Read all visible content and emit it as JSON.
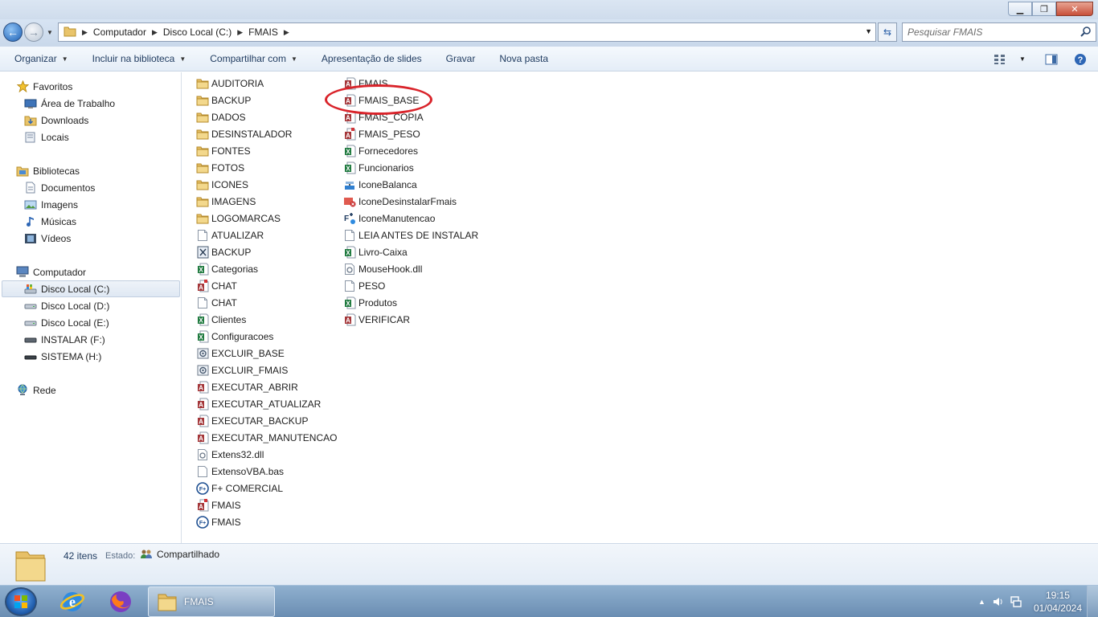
{
  "window": {
    "min_label": "▁",
    "max_label": "❐",
    "close_label": "✕"
  },
  "address": {
    "crumbs": [
      "Computador",
      "Disco Local (C:)",
      "FMAIS"
    ],
    "search_placeholder": "Pesquisar FMAIS"
  },
  "toolbar": {
    "items": [
      "Organizar",
      "Incluir na biblioteca",
      "Compartilhar com",
      "Apresentação de slides",
      "Gravar",
      "Nova pasta"
    ]
  },
  "nav": {
    "favorites": {
      "title": "Favoritos",
      "items": [
        "Área de Trabalho",
        "Downloads",
        "Locais"
      ]
    },
    "libraries": {
      "title": "Bibliotecas",
      "items": [
        "Documentos",
        "Imagens",
        "Músicas",
        "Vídeos"
      ]
    },
    "computer": {
      "title": "Computador",
      "items": [
        "Disco Local (C:)",
        "Disco Local (D:)",
        "Disco Local (E:)",
        "INSTALAR (F:)",
        "SISTEMA (H:)"
      ]
    },
    "network": {
      "title": "Rede"
    }
  },
  "files": {
    "col1": [
      {
        "name": "AUDITORIA",
        "icon": "folder-icon"
      },
      {
        "name": "BACKUP",
        "icon": "folder-icon"
      },
      {
        "name": "DADOS",
        "icon": "folder-icon"
      },
      {
        "name": "DESINSTALADOR",
        "icon": "folder-icon"
      },
      {
        "name": "FONTES",
        "icon": "folder-icon"
      },
      {
        "name": "FOTOS",
        "icon": "folder-icon"
      },
      {
        "name": "ICONES",
        "icon": "folder-icon"
      },
      {
        "name": "IMAGENS",
        "icon": "folder-icon"
      },
      {
        "name": "LOGOMARCAS",
        "icon": "folder-icon"
      },
      {
        "name": "ATUALIZAR",
        "icon": "text-file-icon"
      },
      {
        "name": "BACKUP",
        "icon": "script-file-icon"
      },
      {
        "name": "Categorias",
        "icon": "excel-file-icon"
      },
      {
        "name": "CHAT",
        "icon": "access-lock-file-icon"
      },
      {
        "name": "CHAT",
        "icon": "text-file-icon"
      },
      {
        "name": "Clientes",
        "icon": "excel-file-icon"
      },
      {
        "name": "Configuracoes",
        "icon": "excel-file-icon"
      },
      {
        "name": "EXCLUIR_BASE",
        "icon": "batch-file-icon"
      },
      {
        "name": "EXCLUIR_FMAIS",
        "icon": "batch-file-icon"
      },
      {
        "name": "EXECUTAR_ABRIR",
        "icon": "access-file-icon"
      },
      {
        "name": "EXECUTAR_ATUALIZAR",
        "icon": "access-file-icon"
      },
      {
        "name": "EXECUTAR_BACKUP",
        "icon": "access-file-icon"
      },
      {
        "name": "EXECUTAR_MANUTENCAO",
        "icon": "access-file-icon"
      },
      {
        "name": "Extens32.dll",
        "icon": "dll-file-icon"
      },
      {
        "name": "ExtensoVBA.bas",
        "icon": "blank-file-icon"
      },
      {
        "name": "F+ COMERCIAL",
        "icon": "fmais-app-icon"
      },
      {
        "name": "FMAIS",
        "icon": "access-lock-file-icon"
      },
      {
        "name": "FMAIS",
        "icon": "fmais-app-icon"
      }
    ],
    "col2": [
      {
        "name": "FMAIS",
        "icon": "access-file-icon"
      },
      {
        "name": "FMAIS_BASE",
        "icon": "access-file-icon"
      },
      {
        "name": "FMAIS_COPIA",
        "icon": "access-file-icon"
      },
      {
        "name": "FMAIS_PESO",
        "icon": "access-lock-file-icon"
      },
      {
        "name": "Fornecedores",
        "icon": "excel-file-icon"
      },
      {
        "name": "Funcionarios",
        "icon": "excel-file-icon"
      },
      {
        "name": "IconeBalanca",
        "icon": "scale-app-icon"
      },
      {
        "name": "IconeDesinstalarFmais",
        "icon": "uninstall-app-icon"
      },
      {
        "name": "IconeManutencao",
        "icon": "maintenance-app-icon"
      },
      {
        "name": "LEIA ANTES DE INSTALAR",
        "icon": "text-file-icon"
      },
      {
        "name": "Livro-Caixa",
        "icon": "excel-file-icon"
      },
      {
        "name": "MouseHook.dll",
        "icon": "dll-file-icon"
      },
      {
        "name": "PESO",
        "icon": "text-file-icon"
      },
      {
        "name": "Produtos",
        "icon": "excel-file-icon"
      },
      {
        "name": "VERIFICAR",
        "icon": "access-file-icon"
      }
    ]
  },
  "details": {
    "count": "42 itens",
    "state_label": "Estado:",
    "state_value": "Compartilhado"
  },
  "taskbar": {
    "task_label": "FMAIS",
    "time": "19:15",
    "date": "01/04/2024"
  },
  "colors": {
    "accent": "#1b5fb4",
    "highlight_ring": "#d9232a"
  }
}
